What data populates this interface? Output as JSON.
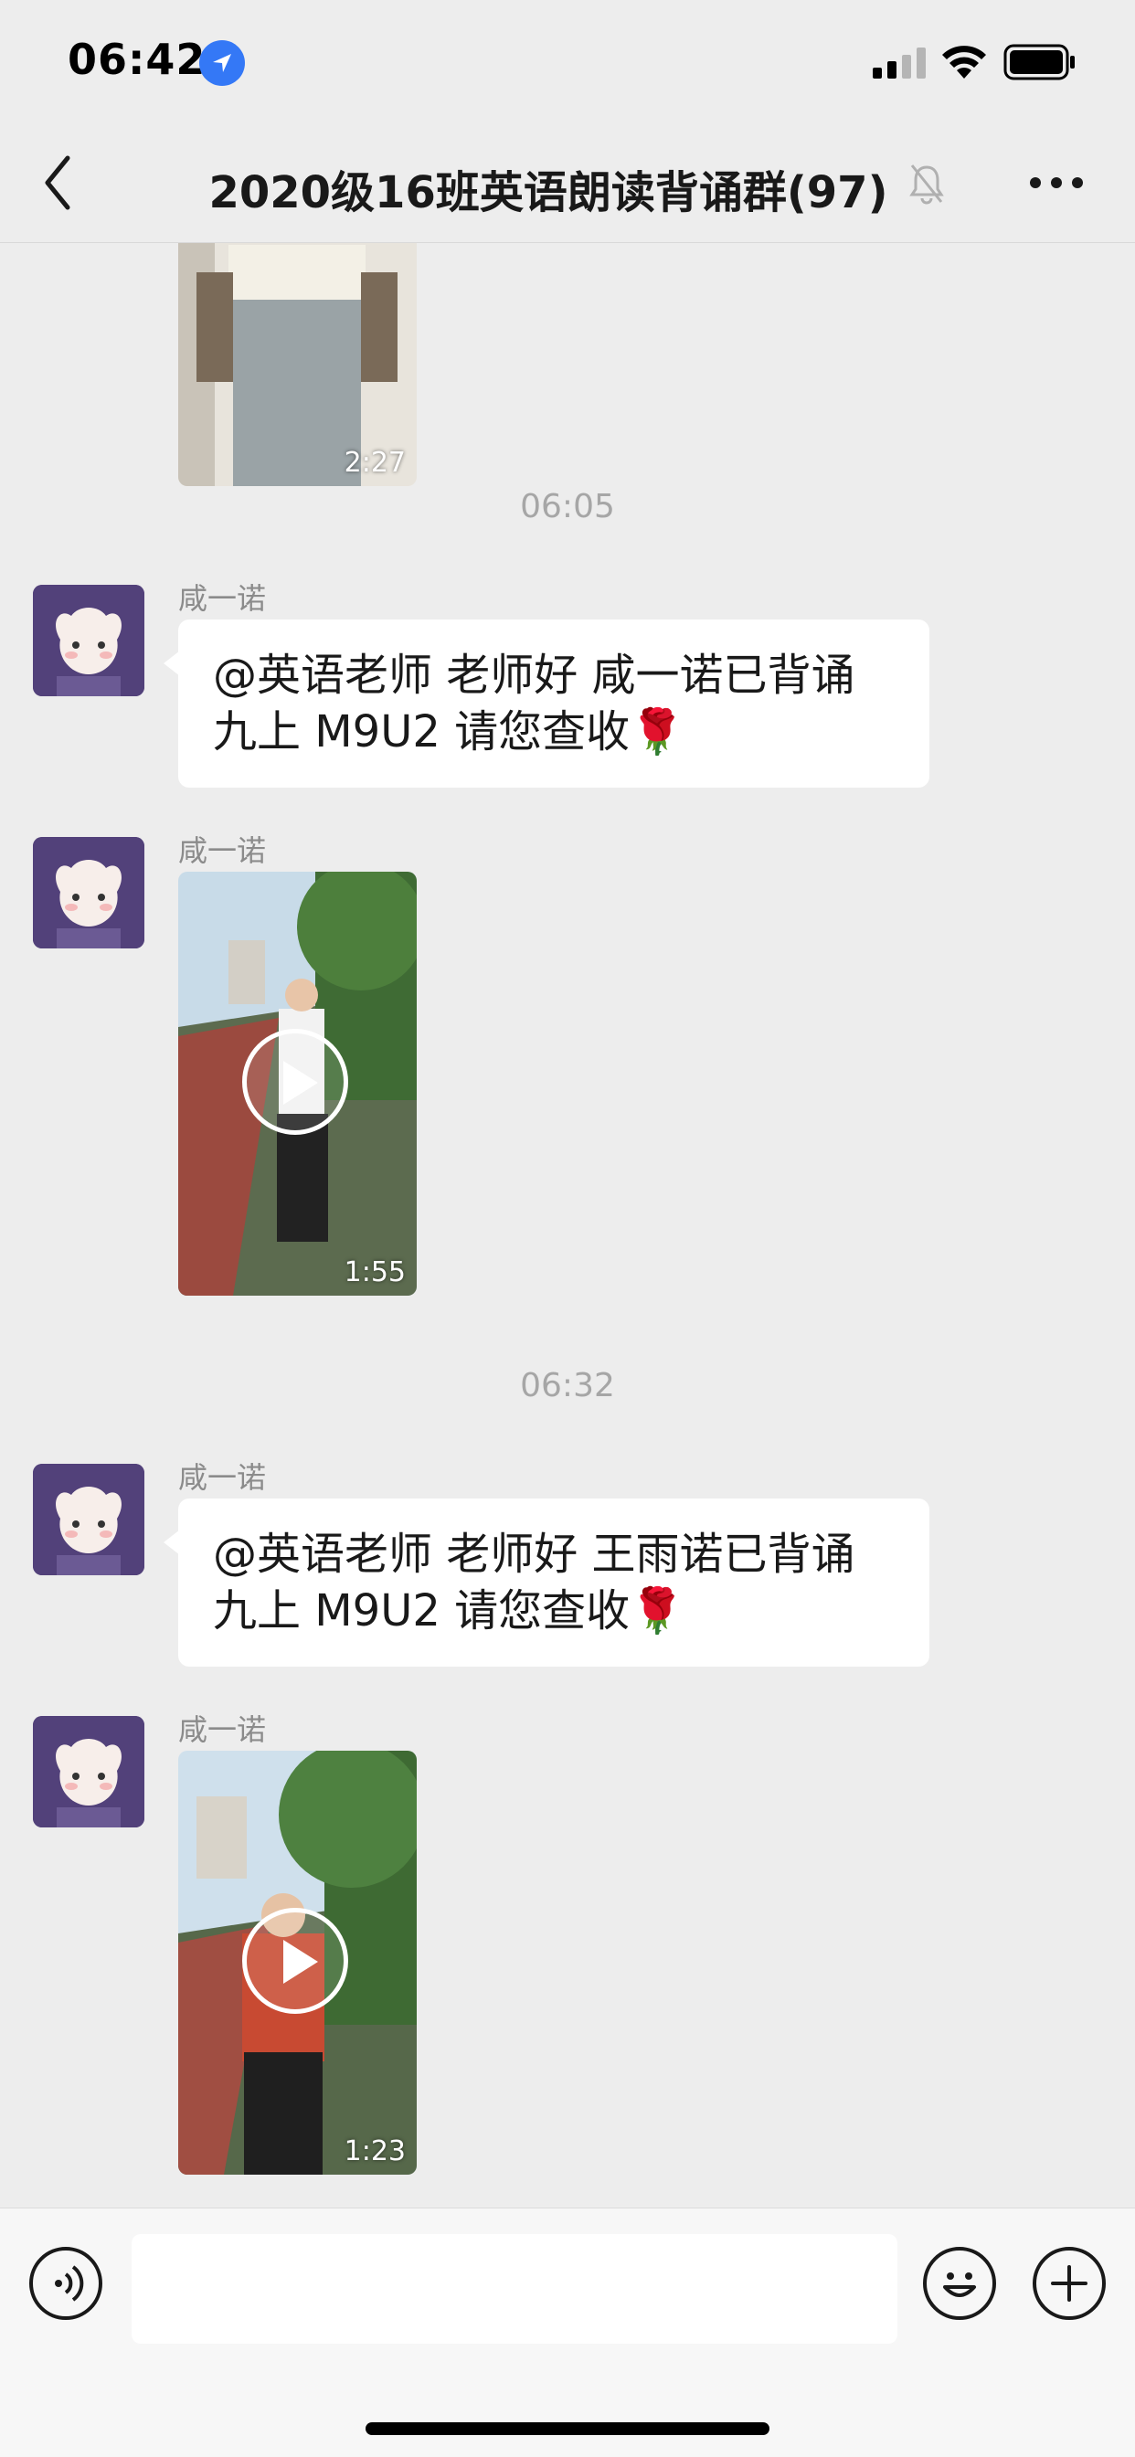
{
  "status_bar": {
    "time": "06:42"
  },
  "nav": {
    "title": "2020级16班英语朗读背诵群(97)",
    "back_icon": "chevron-left-icon",
    "mute_icon": "bell-muted-icon",
    "more_icon": "ellipsis-icon"
  },
  "messages": [
    {
      "type": "video",
      "duration": "2:27"
    },
    {
      "type": "timestamp",
      "text": "06:05"
    },
    {
      "type": "text",
      "sender": "咸一诺",
      "text": "@英语老师 老师好 咸一诺已背诵九上 M9U2 请您查收🌹"
    },
    {
      "type": "video",
      "sender": "咸一诺",
      "duration": "1:55"
    },
    {
      "type": "timestamp",
      "text": "06:32"
    },
    {
      "type": "text",
      "sender": "咸一诺",
      "text": "@英语老师 老师好 王雨诺已背诵九上 M9U2 请您查收🌹"
    },
    {
      "type": "video",
      "sender": "咸一诺",
      "duration": "1:23"
    }
  ],
  "input_bar": {
    "voice_icon": "voice-icon",
    "emoji_icon": "emoji-icon",
    "plus_icon": "plus-icon",
    "text_value": ""
  },
  "colors": {
    "background": "#ededed",
    "bubble": "#ffffff",
    "avatar_bg": "#52417a",
    "accent": "#3478f6"
  }
}
